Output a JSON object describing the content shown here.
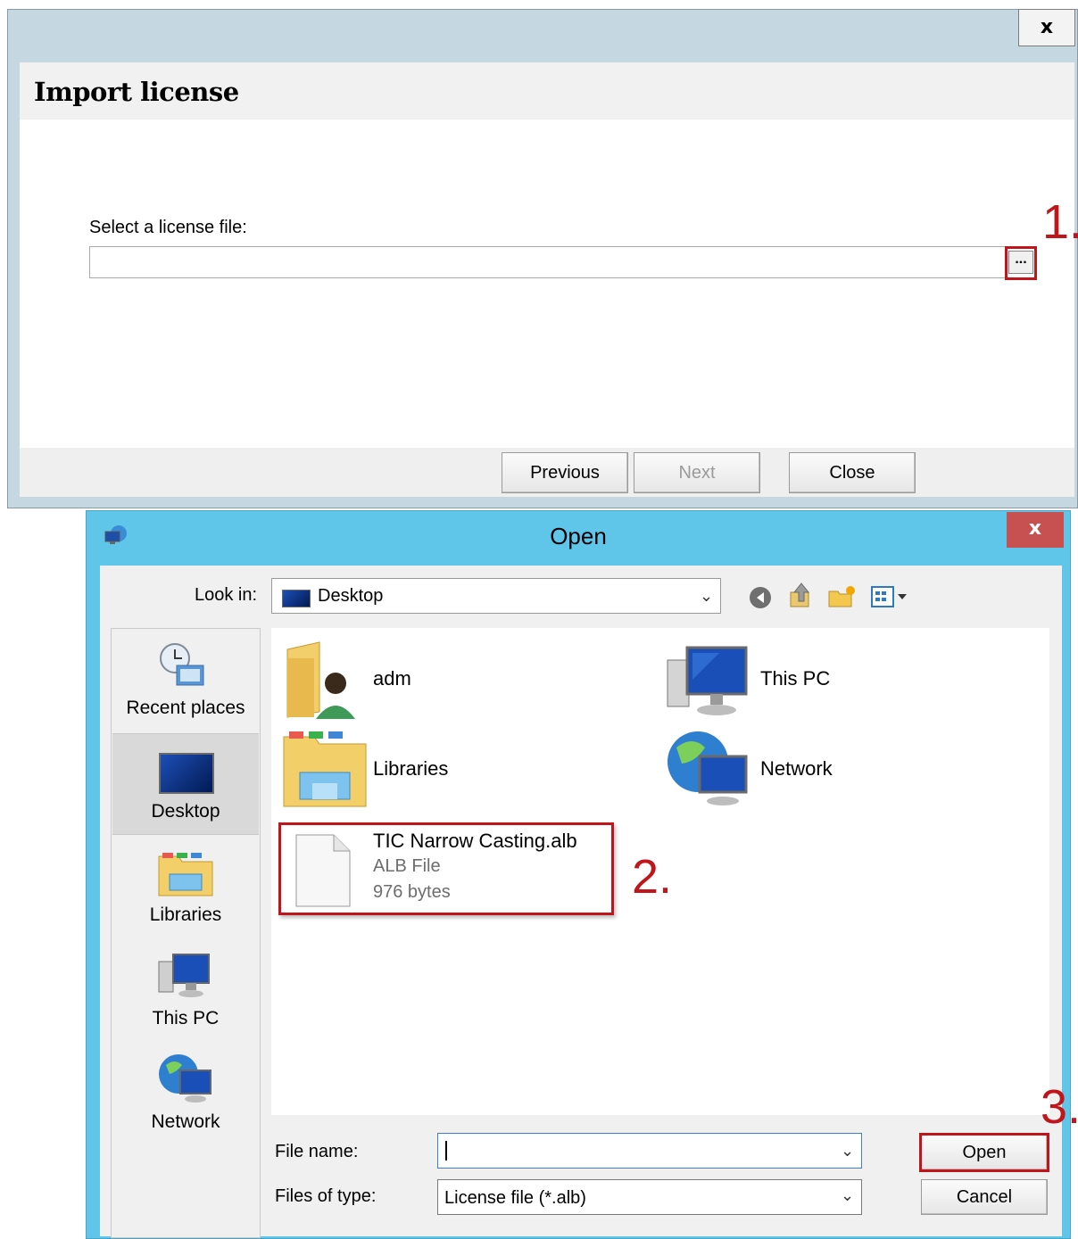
{
  "wizard": {
    "close_label": "x",
    "title": "Import license",
    "file_label": "Select a license file:",
    "file_value": "",
    "browse_label": "...",
    "buttons": {
      "previous": "Previous",
      "next": "Next",
      "close": "Close"
    }
  },
  "callouts": {
    "one": "1.",
    "two": "2.",
    "three": "3."
  },
  "open_dialog": {
    "title": "Open",
    "close_label": "x",
    "look_in_label": "Look in:",
    "look_in_value": "Desktop",
    "places": [
      {
        "label": "Recent places",
        "icon": "recent-places-icon"
      },
      {
        "label": "Desktop",
        "icon": "desktop-icon",
        "selected": true
      },
      {
        "label": "Libraries",
        "icon": "libraries-icon"
      },
      {
        "label": "This PC",
        "icon": "computer-icon"
      },
      {
        "label": "Network",
        "icon": "network-icon"
      }
    ],
    "items": [
      {
        "name": "adm",
        "icon": "user-folder-icon"
      },
      {
        "name": "This PC",
        "icon": "computer-icon"
      },
      {
        "name": "Libraries",
        "icon": "libraries-icon"
      },
      {
        "name": "Network",
        "icon": "network-icon"
      },
      {
        "name": "TIC Narrow Casting.alb",
        "type": "ALB File",
        "size": "976 bytes",
        "icon": "file-icon"
      }
    ],
    "file_name_label": "File name:",
    "file_name_value": "",
    "files_of_type_label": "Files of type:",
    "files_of_type_value": "License file (*.alb)",
    "open_button": "Open",
    "cancel_button": "Cancel"
  },
  "colors": {
    "accent": "#5fc6ea",
    "callout": "#c0151b",
    "close_red": "#c75050"
  }
}
